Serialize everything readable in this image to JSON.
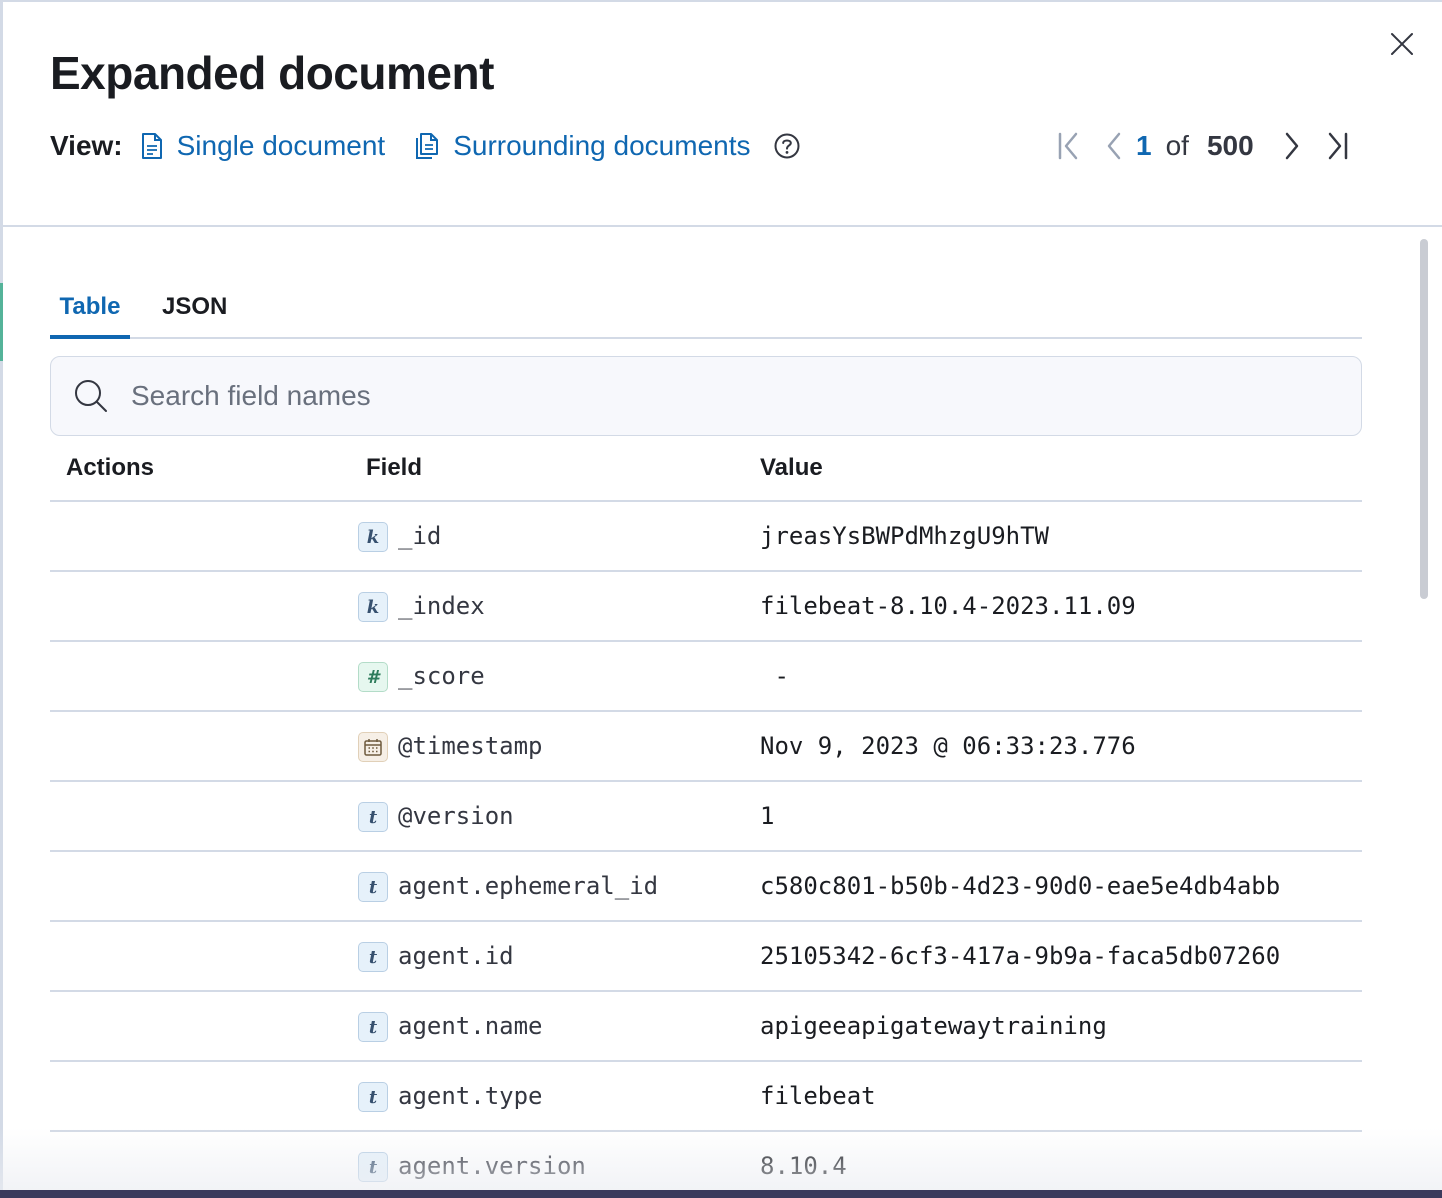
{
  "flyout": {
    "title": "Expanded document",
    "close_icon": "close-icon"
  },
  "view": {
    "label": "View:",
    "single_label": "Single document",
    "surrounding_label": "Surrounding documents",
    "help_icon": "question-circle-icon"
  },
  "pager": {
    "current": "1",
    "of": "of",
    "total": "500"
  },
  "tabs": [
    {
      "label": "Table",
      "active": true
    },
    {
      "label": "JSON",
      "active": false
    }
  ],
  "search": {
    "placeholder": "Search field names"
  },
  "table": {
    "columns": [
      "Actions",
      "Field",
      "Value"
    ],
    "rows": [
      {
        "type_icon": "k",
        "field": "_id",
        "value": "jreasYsBWPdMhzgU9hTW"
      },
      {
        "type_icon": "k",
        "field": "_index",
        "value": "filebeat-8.10.4-2023.11.09"
      },
      {
        "type_icon": "#",
        "field": "_score",
        "value": " -"
      },
      {
        "type_icon": "date",
        "field": "@timestamp",
        "value": "Nov 9, 2023 @ 06:33:23.776"
      },
      {
        "type_icon": "t",
        "field": "@version",
        "value": "1"
      },
      {
        "type_icon": "t",
        "field": "agent.ephemeral_id",
        "value": "c580c801-b50b-4d23-90d0-eae5e4db4abb"
      },
      {
        "type_icon": "t",
        "field": "agent.id",
        "value": "25105342-6cf3-417a-9b9a-faca5db07260"
      },
      {
        "type_icon": "t",
        "field": "agent.name",
        "value": "apigeeapigatewaytraining"
      },
      {
        "type_icon": "t",
        "field": "agent.type",
        "value": "filebeat"
      },
      {
        "type_icon": "t",
        "field": "agent.version",
        "value": "8.10.4"
      }
    ]
  },
  "colors": {
    "accent": "#0f67b1",
    "border": "#d3dae6",
    "text": "#1a1c21"
  }
}
